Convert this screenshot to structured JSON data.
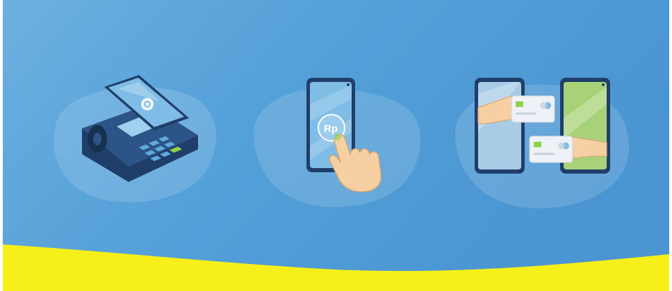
{
  "scene": {
    "colors": {
      "background_left": "#5fa9dc",
      "background_right": "#4a95d2",
      "blob": "#6db4e2",
      "yellow_band": "#f7ef1a",
      "device_dark": "#1f3f6a",
      "screen_blue": "#7fbce6",
      "skin": "#f6cfa2",
      "green_phone": "#a7d277",
      "card": "#eef2f6"
    },
    "illustrations": [
      {
        "name": "nfc-pos-payment",
        "icon": "pos-terminal-with-phone"
      },
      {
        "name": "phone-tap-pay",
        "icon": "hand-tapping-phone",
        "coin_label": "Rp"
      },
      {
        "name": "phone-to-phone-transfer",
        "icon": "card-exchange-between-phones"
      }
    ]
  }
}
